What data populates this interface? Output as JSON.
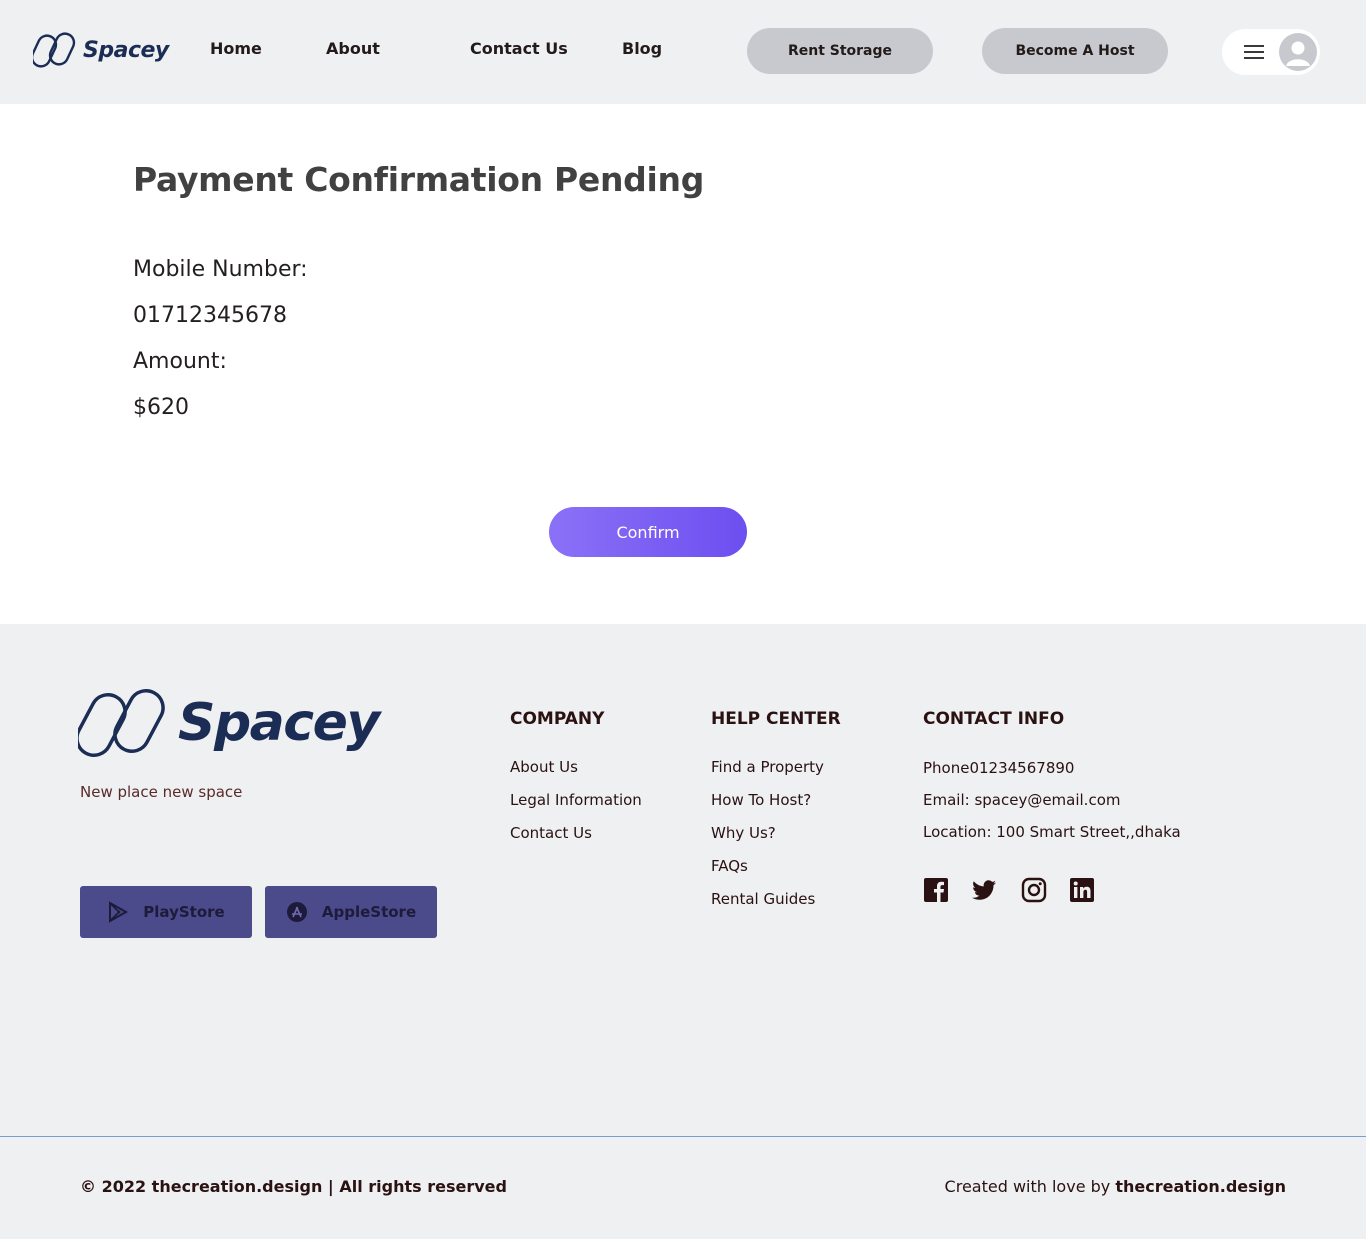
{
  "header": {
    "logo_text": "Spacey",
    "nav": [
      {
        "label": "Home"
      },
      {
        "label": "About"
      },
      {
        "label": "Contact Us"
      },
      {
        "label": "Blog"
      }
    ],
    "rent_storage_label": "Rent Storage",
    "become_host_label": "Become A Host"
  },
  "main": {
    "title": "Payment Confirmation Pending",
    "mobile_label": "Mobile Number:",
    "mobile_value": "01712345678",
    "amount_label": "Amount:",
    "amount_value": "$620",
    "confirm_label": "Confirm"
  },
  "footer": {
    "logo_text": "Spacey",
    "tagline": "New place new  space",
    "playstore_label": "PlayStore",
    "applestore_label": "AppleStore",
    "company": {
      "heading": "COMPANY",
      "links": [
        "About Us",
        "Legal Information",
        "Contact Us"
      ]
    },
    "help": {
      "heading": "HELP CENTER",
      "links": [
        "Find a Property",
        "How To Host?",
        "Why Us?",
        "FAQs",
        "Rental Guides"
      ]
    },
    "contact": {
      "heading": "CONTACT INFO",
      "phone": "Phone01234567890",
      "email": "Email: spacey@email.com",
      "location": "Location: 100 Smart Street,,dhaka"
    },
    "copyright": "© 2022 thecreation.design | All rights reserved",
    "credit_prefix": "Created with love by ",
    "credit_brand": "thecreation.design"
  },
  "colors": {
    "brand": "#1b2d55",
    "accent": "#6c4ff0",
    "store_button": "#4b4a8b",
    "header_bg": "#eff0f2"
  },
  "icons": {
    "social": [
      "facebook-icon",
      "twitter-icon",
      "instagram-icon",
      "linkedin-icon"
    ]
  }
}
